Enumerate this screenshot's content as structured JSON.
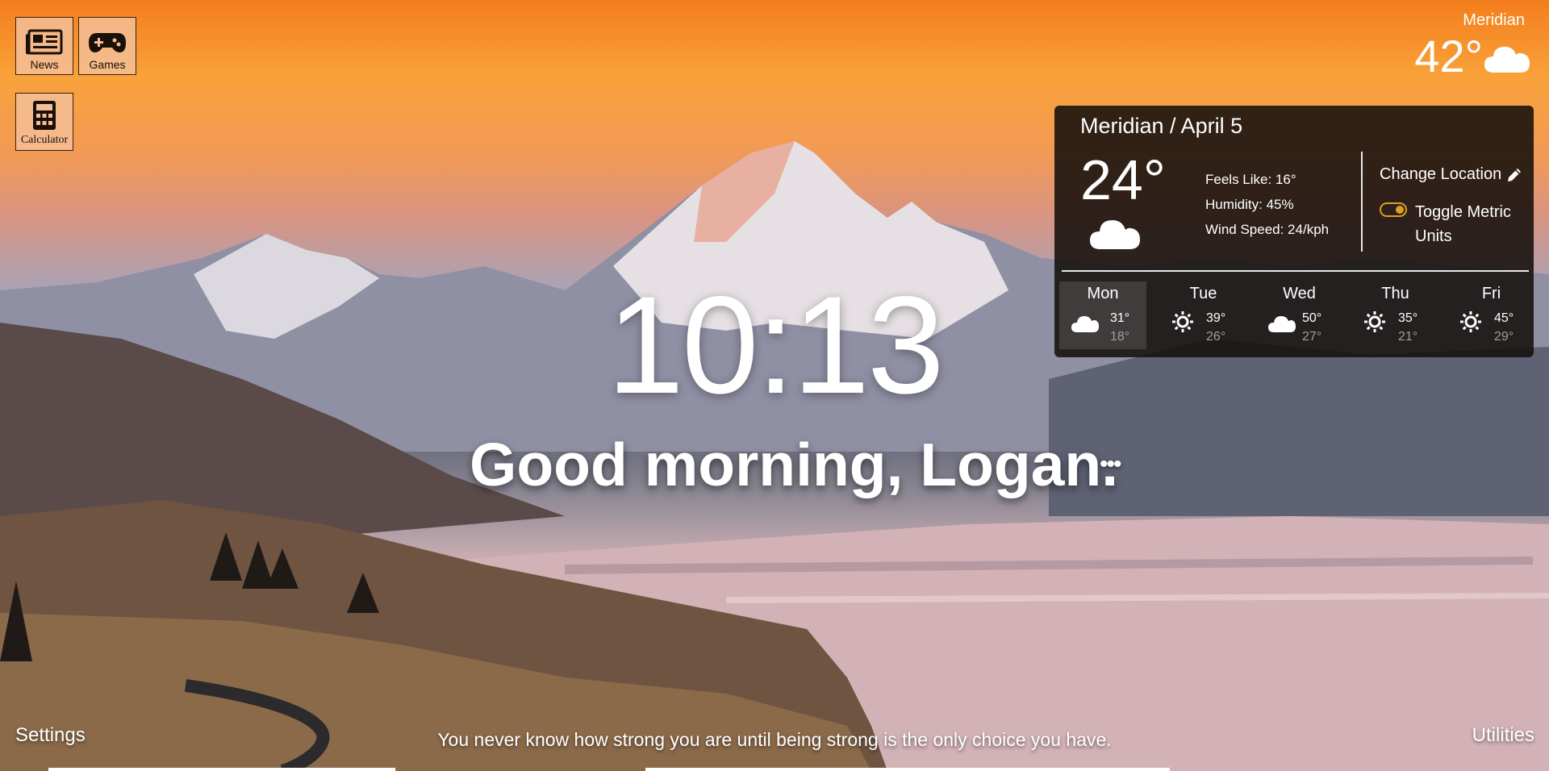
{
  "shortcuts": [
    {
      "label": "News",
      "icon": "newspaper-icon"
    },
    {
      "label": "Games",
      "icon": "gamepad-icon"
    },
    {
      "label": "Calculator",
      "icon": "calculator-icon"
    }
  ],
  "top_weather": {
    "city": "Meridian",
    "temp": "42°",
    "icon": "cloud-icon"
  },
  "weather_card": {
    "title": "Meridian / April 5",
    "temp": "24°",
    "icon": "cloud-icon",
    "feels_like": "Feels Like: 16°",
    "humidity": "Humidity: 45%",
    "wind": "Wind Speed: 24/kph",
    "change_location": "Change Location",
    "toggle_label": "Toggle Metric Units",
    "toggle_on": true,
    "forecast": [
      {
        "day": "Mon",
        "icon": "cloud-icon",
        "hi": "31°",
        "lo": "18°"
      },
      {
        "day": "Tue",
        "icon": "sun-icon",
        "hi": "39°",
        "lo": "26°"
      },
      {
        "day": "Wed",
        "icon": "cloud-icon",
        "hi": "50°",
        "lo": "27°"
      },
      {
        "day": "Thu",
        "icon": "sun-icon",
        "hi": "35°",
        "lo": "21°"
      },
      {
        "day": "Fri",
        "icon": "sun-icon",
        "hi": "45°",
        "lo": "29°"
      }
    ]
  },
  "clock": "10:13",
  "greeting": "Good morning, Logan.",
  "more_label": "•••",
  "settings_label": "Settings",
  "utilities_label": "Utilities",
  "quote": "You never know how strong you are until being strong is the only choice you have.",
  "colors": {
    "toggle_accent": "#d9a021",
    "card_bg": "#16100c",
    "shortcut_bg": "#f5be96"
  }
}
